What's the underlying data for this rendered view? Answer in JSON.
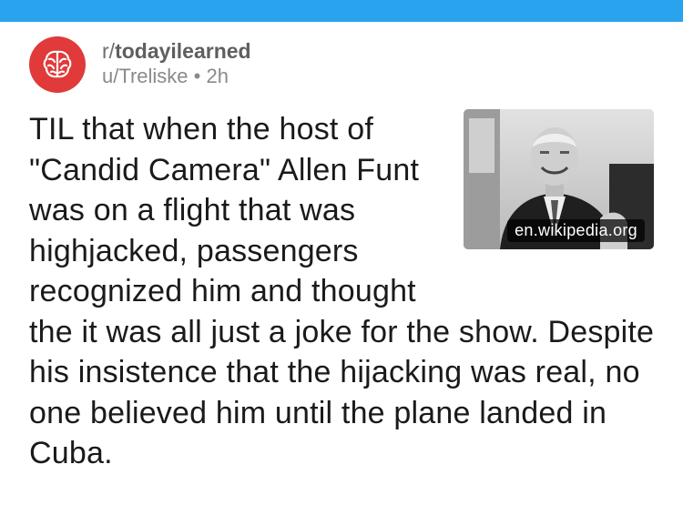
{
  "colors": {
    "topbar": "#2aa3ef",
    "avatar": "#e03a3a"
  },
  "post": {
    "subreddit_prefix": "r/",
    "subreddit": "todayilearned",
    "byline": "u/Treliske • 2h",
    "title": "TIL that when the host of \"Candid Camera\" Allen Funt was on a flight that was highjacked, passengers recognized him and thought the it was all just a joke for the show. Despite his insistence that the hijacking was real, no one believed him until the plane landed in Cuba.",
    "link_domain": "en.wikipedia.org",
    "avatar_icon": "brain-icon",
    "thumbnail": "thumbnail-image"
  }
}
